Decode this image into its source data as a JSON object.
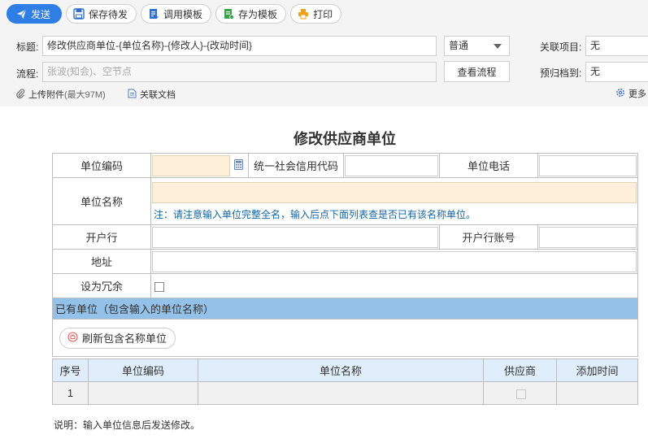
{
  "toolbar": {
    "send_label": "发送",
    "save_draft_label": "保存待发",
    "use_template_label": "调用模板",
    "save_template_label": "存为模板",
    "print_label": "打印"
  },
  "header": {
    "title_label": "标题:",
    "title_value": "修改供应商单位-{单位名称}-{修改人}-{改动时间}",
    "priority_value": "普通",
    "related_project_label": "关联项目:",
    "related_project_value": "无",
    "flow_label": "流程:",
    "flow_placeholder": "张波(知会)、空节点",
    "view_flow_label": "查看流程",
    "archive_label": "预归档到:",
    "archive_value": "无",
    "attach_label": "上传附件",
    "attach_limit": "(最大97M)",
    "related_doc_label": "关联文档",
    "more_label": "更多"
  },
  "form": {
    "title": "修改供应商单位",
    "unit_code_label": "单位编码",
    "credit_code_label": "统一社会信用代码",
    "phone_label": "单位电话",
    "unit_name_label": "单位名称",
    "unit_name_note": "注：请注意输入单位完整全名，输入后点下面列表查是否已有该名称单位。",
    "bank_label": "开户行",
    "bank_account_label": "开户行账号",
    "address_label": "地址",
    "redundant_label": "设为冗余",
    "existing_section_label": "已有单位（包含输入的单位名称）",
    "refresh_label": "刷新包含名称单位"
  },
  "list": {
    "columns": [
      "序号",
      "单位编码",
      "单位名称",
      "供应商",
      "添加时间"
    ],
    "rows": [
      {
        "index": "1",
        "code": "",
        "name": "",
        "time": ""
      }
    ]
  },
  "footer": {
    "note": "说明：输入单位信息后发送修改。"
  },
  "colors": {
    "primary": "#2f7ee6",
    "section_header": "#93c1e8",
    "list_header": "#dfeefa",
    "warn_input": "#fdefd9",
    "note_text": "#1565a0"
  }
}
